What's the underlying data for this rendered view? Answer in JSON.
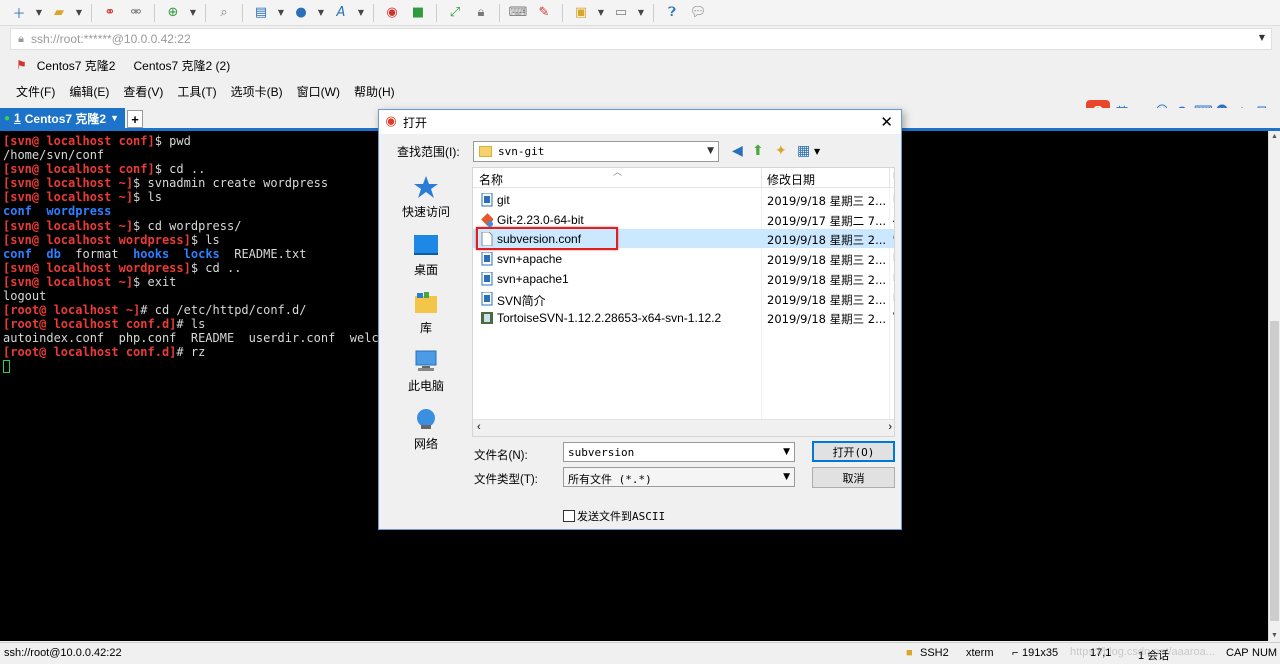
{
  "toolbar": {
    "icons": [
      "new-session-icon",
      "open-folder-icon",
      "connect-icon",
      "disconnect-icon",
      "new-tab-icon",
      "search-icon",
      "properties-icon",
      "globe-icon",
      "font-icon",
      "xshell-icon",
      "xftp-icon",
      "fullscreen-icon",
      "lock-icon",
      "keyboard-icon",
      "script-icon",
      "compose-icon",
      "layout-icon",
      "help-icon",
      "chat-icon"
    ]
  },
  "address": {
    "text": "ssh://root:******@10.0.0.42:22"
  },
  "links": [
    "Centos7 克隆2",
    "Centos7 克隆2 (2)"
  ],
  "menu": [
    "文件(F)",
    "编辑(E)",
    "查看(V)",
    "工具(T)",
    "选项卡(B)",
    "窗口(W)",
    "帮助(H)"
  ],
  "ime": {
    "logo": "S",
    "lang": "英",
    "punct": "•,",
    "face": "☺",
    "mic": "🎤",
    "kbd": "⌨",
    "user": "👥",
    "shirt": "👕",
    "grid": "⊞"
  },
  "tab": {
    "number": "1",
    "title": "Centos7 克隆2",
    "plus": "+"
  },
  "terminal": {
    "lines": [
      [
        [
          "[svn@ localhost conf]",
          "red"
        ],
        [
          "$ pwd",
          ""
        ]
      ],
      [
        [
          "/home/svn/conf",
          ""
        ]
      ],
      [
        [
          "[svn@ localhost conf]",
          "red"
        ],
        [
          "$ cd ..",
          ""
        ]
      ],
      [
        [
          "[svn@ localhost ~]",
          "red"
        ],
        [
          "$ svnadmin create wordpress",
          ""
        ]
      ],
      [
        [
          "[svn@ localhost ~]",
          "red"
        ],
        [
          "$ ls",
          ""
        ]
      ],
      [
        [
          "conf",
          "blue"
        ],
        [
          "  ",
          ""
        ],
        [
          "wordpress",
          "blue"
        ]
      ],
      [
        [
          "[svn@ localhost ~]",
          "red"
        ],
        [
          "$ cd wordpress/",
          ""
        ]
      ],
      [
        [
          "[svn@ localhost wordpress]",
          "red"
        ],
        [
          "$ ls",
          ""
        ]
      ],
      [
        [
          "conf",
          "blue"
        ],
        [
          "  ",
          ""
        ],
        [
          "db",
          "blue"
        ],
        [
          "  format  ",
          ""
        ],
        [
          "hooks",
          "blue"
        ],
        [
          "  ",
          ""
        ],
        [
          "locks",
          "blue"
        ],
        [
          "  README.txt",
          ""
        ]
      ],
      [
        [
          "[svn@ localhost wordpress]",
          "red"
        ],
        [
          "$ cd ..",
          ""
        ]
      ],
      [
        [
          "[svn@ localhost ~]",
          "red"
        ],
        [
          "$ exit",
          ""
        ]
      ],
      [
        [
          "logout",
          ""
        ]
      ],
      [
        [
          "[root@ localhost ~]",
          "red"
        ],
        [
          "# cd /etc/httpd/conf.d/",
          ""
        ]
      ],
      [
        [
          "[root@ localhost conf.d]",
          "red"
        ],
        [
          "# ls",
          ""
        ]
      ],
      [
        [
          "autoindex.conf  php.conf  README  userdir.conf  welcome.conf",
          ""
        ]
      ],
      [
        [
          "[root@ localhost conf.d]",
          "red"
        ],
        [
          "# rz",
          ""
        ]
      ]
    ]
  },
  "dialog": {
    "title": "打开",
    "lookin_label": "查找范围(I):",
    "lookin_value": "svn-git",
    "places": [
      "快速访问",
      "桌面",
      "库",
      "此电脑",
      "网络"
    ],
    "columns": {
      "name": "名称",
      "date": "修改日期",
      "type": "Ⅱ"
    },
    "files": [
      {
        "name": "git",
        "date": "2019/9/18 星期三 2...",
        "type": "D",
        "icon": "folder-doc-icon"
      },
      {
        "name": "Git-2.23.0-64-bit",
        "date": "2019/9/17 星期二 7...",
        "type": "A",
        "icon": "git-installer-icon"
      },
      {
        "name": "subversion.conf",
        "date": "2019/9/18 星期三 2...",
        "type": "C",
        "icon": "file-icon"
      },
      {
        "name": "svn+apache",
        "date": "2019/9/18 星期三 2...",
        "type": "D",
        "icon": "word-doc-icon"
      },
      {
        "name": "svn+apache1",
        "date": "2019/9/18 星期三 2...",
        "type": "D",
        "icon": "word-doc-icon"
      },
      {
        "name": "SVN简介",
        "date": "2019/9/18 星期三 2...",
        "type": "D",
        "icon": "word-doc-icon"
      },
      {
        "name": "TortoiseSVN-1.12.2.28653-x64-svn-1.12.2",
        "date": "2019/9/18 星期三 2...",
        "type": "W",
        "icon": "msi-installer-icon"
      }
    ],
    "selected_index": 2,
    "filename_label": "文件名(N):",
    "filename_value": "subversion",
    "filetype_label": "文件类型(T):",
    "filetype_value": "所有文件 (*.*)",
    "open_button": "打开(O)",
    "cancel_button": "取消",
    "ascii_label": "发送文件到ASCII",
    "ascii_checked": false
  },
  "status": {
    "left": "ssh://root@10.0.0.42:22",
    "ssh": "SSH2",
    "term": "xterm",
    "size": "191x35",
    "pos": "17,1",
    "sessions": "1 会话",
    "cap": "CAP",
    "num": "NUM",
    "watermark": "https://blog.csdn.net/aaaroa..."
  },
  "colors": {
    "accent": "#1d73c9",
    "prompt": "#ea3b36",
    "dir": "#2f7fff",
    "selection": "#cce8ff",
    "highlight": "#e02020"
  }
}
